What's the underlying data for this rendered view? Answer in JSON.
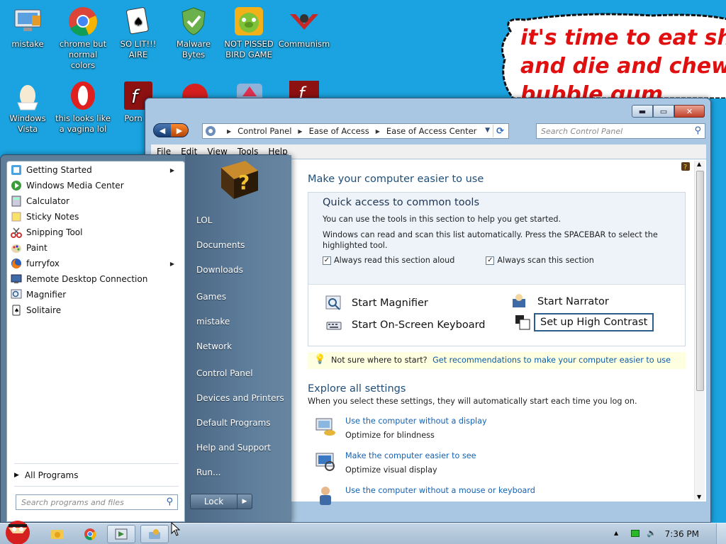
{
  "desktop_icons": [
    {
      "label": "mistake",
      "icon": "computer-icon"
    },
    {
      "label": "chrome but normal colors",
      "icon": "chrome-icon"
    },
    {
      "label": "SO LIT!!! AIRE",
      "icon": "solitaire-icon"
    },
    {
      "label": "Malware Bytes",
      "icon": "shield-icon"
    },
    {
      "label": "NOT PISSED BIRD GAME",
      "icon": "pig-icon"
    },
    {
      "label": "Communism",
      "icon": "communism-icon"
    },
    {
      "label": "Windows Vista",
      "icon": "egg-icon"
    },
    {
      "label": "this looks like a vagina lol",
      "icon": "opera-icon"
    },
    {
      "label": "Porn Pl",
      "icon": "flash-icon"
    }
  ],
  "speech_bubble": {
    "line1": "it's time to eat shit",
    "line2": "and die and chew",
    "line3": "bubble gum"
  },
  "window": {
    "nav": {
      "back": "◀",
      "forward": "▶"
    },
    "breadcrumb": [
      "Control Panel",
      "Ease of Access",
      "Ease of Access Center"
    ],
    "search_placeholder": "Search Control Panel",
    "menu": [
      "File",
      "Edit",
      "View",
      "Tools",
      "Help"
    ],
    "buttons": {
      "minimize": "▬",
      "maximize": "▭",
      "close": "✕"
    }
  },
  "content": {
    "heading": "Make your computer easier to use",
    "quick_title": "Quick access to common tools",
    "quick_p1": "You can use the tools in this section to help you get started.",
    "quick_p2": "Windows can read and scan this list automatically.  Press the SPACEBAR to select the highlighted tool.",
    "check_read": "Always read this section aloud",
    "check_scan": "Always scan this section",
    "tools": {
      "magnifier": "Start Magnifier",
      "narrator": "Start Narrator",
      "keyboard": "Start On-Screen Keyboard",
      "contrast": "Set up High Contrast"
    },
    "tip_text": "Not sure where to start?",
    "tip_link": "Get recommendations to make your computer easier to use",
    "explore_title": "Explore all settings",
    "explore_sub": "When you select these settings, they will automatically start each time you log on.",
    "settings": [
      {
        "link": "Use the computer without a display",
        "desc": "Optimize for blindness"
      },
      {
        "link": "Make the computer easier to see",
        "desc": "Optimize visual display"
      },
      {
        "link": "Use the computer without a mouse or keyboard",
        "desc": ""
      }
    ]
  },
  "start_menu": {
    "programs": [
      {
        "label": "Getting Started",
        "icon": "getting-started-icon",
        "submenu": true
      },
      {
        "label": "Windows Media Center",
        "icon": "media-center-icon",
        "submenu": false
      },
      {
        "label": "Calculator",
        "icon": "calculator-icon",
        "submenu": false
      },
      {
        "label": "Sticky Notes",
        "icon": "sticky-notes-icon",
        "submenu": false
      },
      {
        "label": "Snipping Tool",
        "icon": "scissors-icon",
        "submenu": false
      },
      {
        "label": "Paint",
        "icon": "paint-icon",
        "submenu": false
      },
      {
        "label": "furryfox",
        "icon": "firefox-icon",
        "submenu": true
      },
      {
        "label": "Remote Desktop Connection",
        "icon": "remote-desktop-icon",
        "submenu": false
      },
      {
        "label": "Magnifier",
        "icon": "magnifier-icon",
        "submenu": false
      },
      {
        "label": "Solitaire",
        "icon": "solitaire-icon",
        "submenu": false
      }
    ],
    "all_programs": "All Programs",
    "search_placeholder": "Search programs and files",
    "right_links": [
      "LOL",
      "Documents",
      "Downloads",
      "Games",
      "mistake",
      "Network",
      "Control Panel",
      "Devices and Printers",
      "Default Programs",
      "Help and Support",
      "Run..."
    ],
    "lock": "Lock"
  },
  "taskbar": {
    "clock": "7:36 PM",
    "items": [
      "start-orb",
      "explorer-icon",
      "chrome-icon",
      "control-panel-icon",
      "ease-of-access-icon"
    ]
  },
  "colors": {
    "desktop": "#1aa3e0",
    "bubble_text": "#e01010",
    "link": "#1562b1"
  }
}
